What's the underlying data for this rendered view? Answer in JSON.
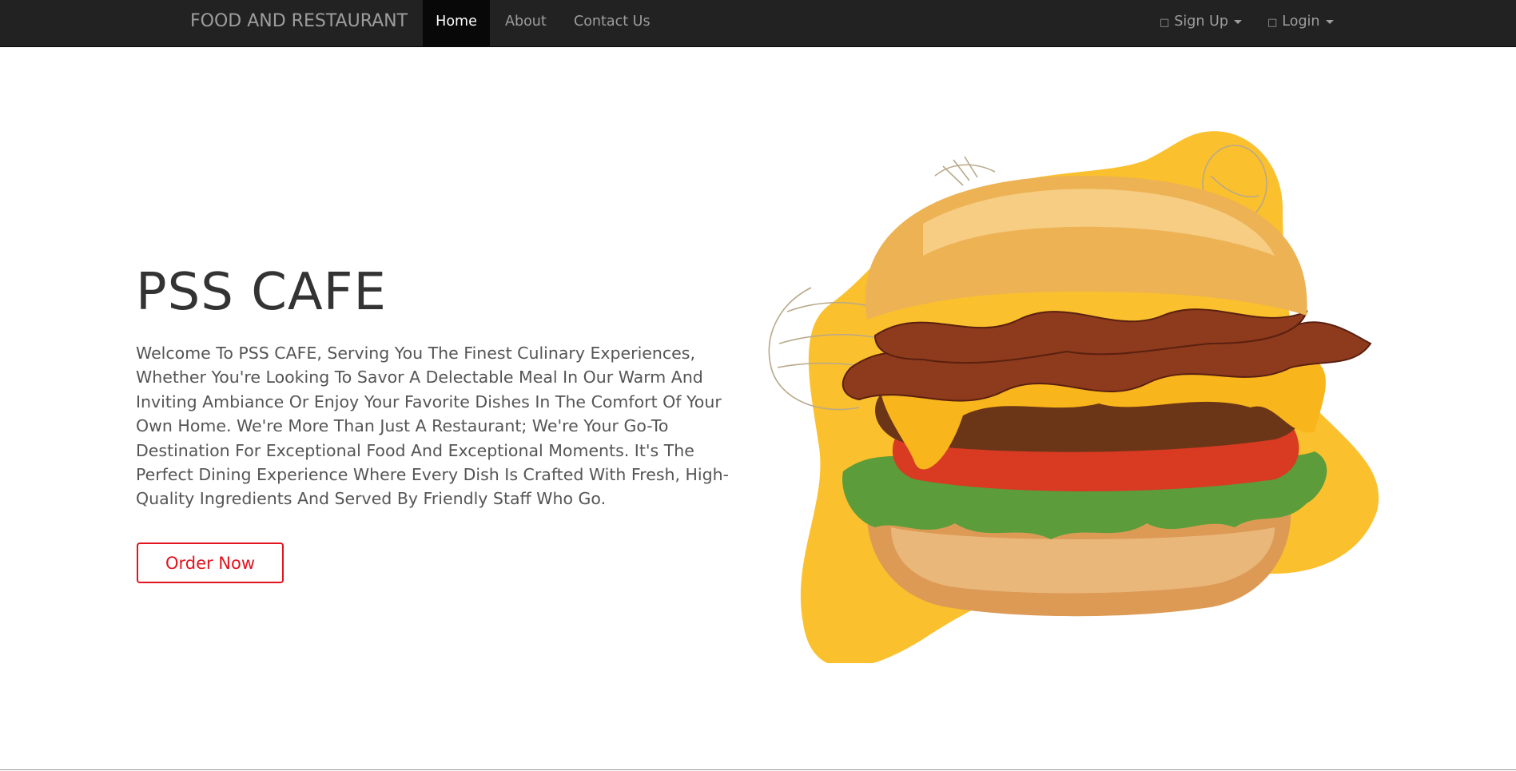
{
  "navbar": {
    "brand": "FOOD AND RESTAURANT",
    "links": [
      {
        "label": "Home",
        "active": true
      },
      {
        "label": "About",
        "active": false
      },
      {
        "label": "Contact Us",
        "active": false
      }
    ],
    "right": [
      {
        "icon": "user-icon",
        "label": "Sign Up"
      },
      {
        "icon": "login-icon",
        "label": "Login"
      }
    ],
    "colors": {
      "background": "#222222",
      "text": "#9d9d9d",
      "active_bg": "#080808",
      "active_text": "#ffffff"
    }
  },
  "hero": {
    "title": "PSS CAFE",
    "description": "Welcome To PSS CAFE, Serving You The Finest Culinary Experiences, Whether You're Looking To Savor A Delectable Meal In Our Warm And Inviting Ambiance Or Enjoy Your Favorite Dishes In The Comfort Of Your Own Home. We're More Than Just A Restaurant; We're Your Go-To Destination For Exceptional Food And Exceptional Moments. It's The Perfect Dining Experience Where Every Dish Is Crafted With Fresh, High-Quality Ingredients And Served By Friendly Staff Who Go.",
    "button": "Order Now",
    "image": "bacon-cheeseburger-illustration",
    "colors": {
      "accent": "#e2141e",
      "blob": "#fbc02d"
    }
  }
}
